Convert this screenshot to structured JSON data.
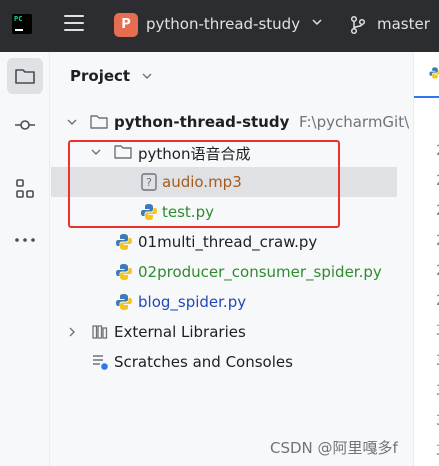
{
  "titlebar": {
    "project_badge": "P",
    "project_name": "python-thread-study",
    "branch": "master",
    "logo_text": "PC"
  },
  "toolstrip": {
    "items": [
      {
        "icon": "folder-icon"
      },
      {
        "icon": "commit-icon"
      },
      {
        "icon": "structure-icon"
      },
      {
        "icon": "more-icon"
      }
    ]
  },
  "panel": {
    "title": "Project"
  },
  "tree": {
    "root_label": "python-thread-study",
    "root_path": "F:\\pycharmGit\\",
    "folder_label": "python语音合成",
    "audio_file": "audio.mp3",
    "test_file": "test.py",
    "file_1": "01multi_thread_craw.py",
    "file_2": "02producer_consumer_spider.py",
    "file_3": "blog_spider.py",
    "external_libraries": "External Libraries",
    "scratches": "Scratches and Consoles"
  },
  "editor": {
    "line_digits": [
      "2",
      "2",
      "2",
      "2",
      "2",
      "2",
      "3",
      "3",
      "3",
      "3",
      "3",
      "3",
      "3"
    ]
  },
  "watermark": "CSDN @阿里嘎多f",
  "colors": {
    "titlebar_bg": "#2b2d30",
    "selected_row": "#dfe1e5",
    "highlight_red": "#e8342d",
    "file_brown": "#a35c1d",
    "file_green": "#2e8b2e",
    "file_blue": "#2548b7",
    "project_badge": "#e66d4f"
  }
}
